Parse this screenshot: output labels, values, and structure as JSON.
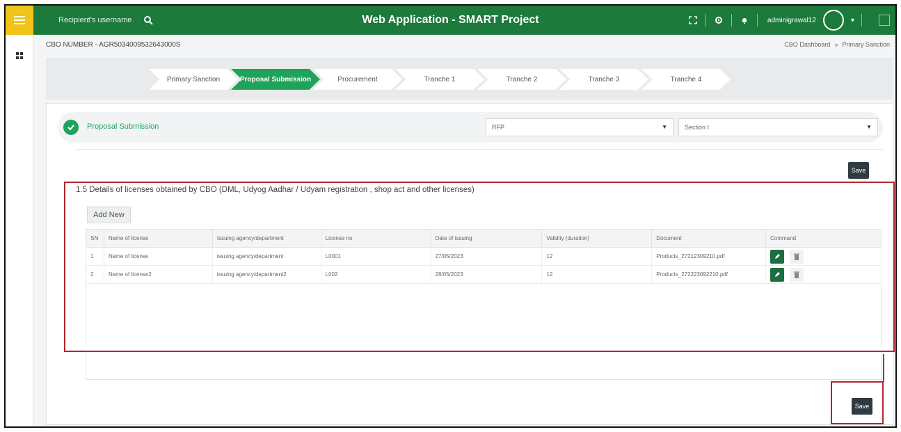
{
  "header": {
    "search_placeholder": "Recipient's username",
    "title": "Web Application - SMART Project",
    "username": "adminigrawal12",
    "icons": [
      "fullscreen-icon",
      "settings-icon",
      "notification-icon"
    ]
  },
  "crumb": {
    "cbo_number": "CBO NUMBER - AGR5034009532643000S",
    "breadcrumb": [
      "CBO Dashboard",
      "»",
      "Primary Sanction"
    ]
  },
  "stepper": {
    "steps": [
      {
        "label": "Primary Sanction",
        "active": false
      },
      {
        "label": "Proposal Submission",
        "active": true
      },
      {
        "label": "Procurement",
        "active": false
      },
      {
        "label": "Tranche 1",
        "active": false
      },
      {
        "label": "Tranche 2",
        "active": false
      },
      {
        "label": "Tranche 3",
        "active": false
      },
      {
        "label": "Tranche 4",
        "active": false
      }
    ]
  },
  "status": {
    "label": "Proposal Submission",
    "select_1": "RFP",
    "select_2": "Section I"
  },
  "section": {
    "title": "1.5 Details of licenses obtained by CBO (DML, Udyog Aadhar / Udyam registration , shop act and other licenses)",
    "add_new_label": "Add New",
    "save_label": "Save"
  },
  "table": {
    "headers": [
      "SN",
      "Name of license",
      "Issuing agency/department",
      "License no",
      "Date of issuing",
      "Validity (duration)",
      "Document",
      "Command"
    ],
    "rows": [
      [
        "1",
        "Name of license",
        "issuing agency/department",
        "L0001",
        "27/05/2023",
        "12",
        "Products_27212309210.pdf"
      ],
      [
        "2",
        "Name of license2",
        "issuing agency/department2",
        "L002",
        "28/05/2023",
        "12",
        "Products_272223092210.pdf"
      ]
    ]
  },
  "colors": {
    "header_green": "#1c7a3c",
    "accent_green": "#1fa25a",
    "menu_yellow": "#f0c419",
    "highlight_red": "#b3262d",
    "save_dark": "#2f3b42"
  }
}
